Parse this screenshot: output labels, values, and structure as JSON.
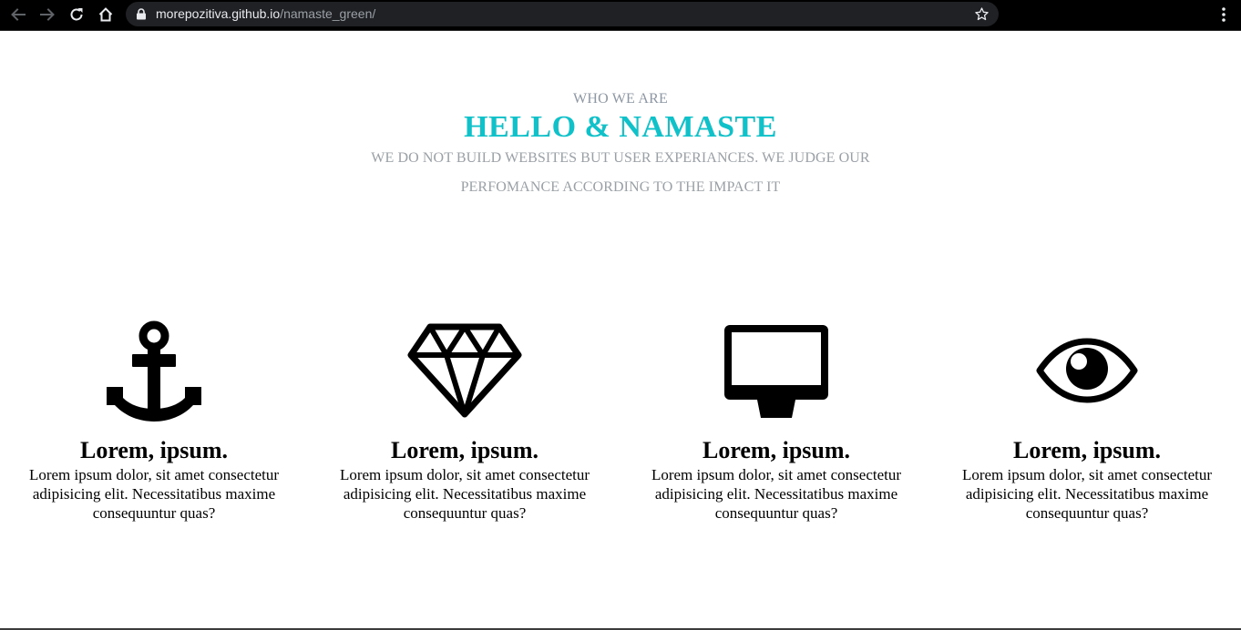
{
  "browser": {
    "url_domain": "morepozitiva.github.io",
    "url_path": "/namaste_green/",
    "icons": [
      "back-icon",
      "forward-icon",
      "reload-icon",
      "home-icon",
      "lock-icon",
      "bookmark-star-icon",
      "kebab-menu-icon"
    ]
  },
  "hero": {
    "eyebrow": "WHO WE ARE",
    "headline": "HELLO & NAMASTE",
    "tagline": "WE DO NOT BUILD WEBSITES BUT USER EXPERIANCES. WE JUDGE OUR PERFOMANCE ACCORDING TO THE IMPACT IT"
  },
  "features": [
    {
      "icon": "anchor-icon",
      "title": "Lorem, ipsum.",
      "text": "Lorem ipsum dolor, sit amet consectetur adipisicing elit. Necessitatibus maxime consequuntur quas?"
    },
    {
      "icon": "diamond-icon",
      "title": "Lorem, ipsum.",
      "text": "Lorem ipsum dolor, sit amet consectetur adipisicing elit. Necessitatibus maxime consequuntur quas?"
    },
    {
      "icon": "desktop-monitor-icon",
      "title": "Lorem, ipsum.",
      "text": "Lorem ipsum dolor, sit amet consectetur adipisicing elit. Necessitatibus maxime consequuntur quas?"
    },
    {
      "icon": "eye-icon",
      "title": "Lorem, ipsum.",
      "text": "Lorem ipsum dolor, sit amet consectetur adipisicing elit. Necessitatibus maxime consequuntur quas?"
    }
  ],
  "colors": {
    "accent": "#10c1c9",
    "muted_text": "#9aa0a6",
    "chrome_bg": "#000000",
    "omnibox_bg": "#202124"
  }
}
